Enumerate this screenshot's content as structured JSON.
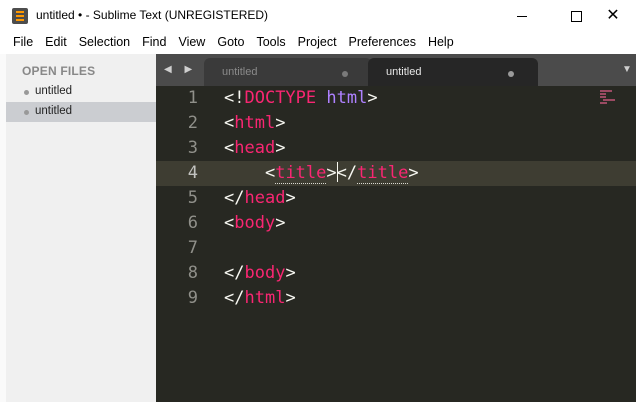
{
  "window": {
    "title": "untitled • - Sublime Text (UNREGISTERED)",
    "minimize": "–",
    "maximize": "□",
    "close": "✕"
  },
  "menu": [
    "File",
    "Edit",
    "Selection",
    "Find",
    "View",
    "Goto",
    "Tools",
    "Project",
    "Preferences",
    "Help"
  ],
  "sidebar": {
    "header": "OPEN FILES",
    "items": [
      {
        "label": "untitled",
        "active": false
      },
      {
        "label": "untitled",
        "active": true
      }
    ]
  },
  "tabs": {
    "nav": "◀ ▶",
    "items": [
      {
        "label": "untitled",
        "active": false
      },
      {
        "label": "untitled",
        "active": true
      }
    ],
    "dropdown": "▼"
  },
  "editor": {
    "current_line": 4,
    "lines": [
      {
        "n": "1",
        "text": "<!DOCTYPE html>"
      },
      {
        "n": "2",
        "text": "<html>"
      },
      {
        "n": "3",
        "text": "<head>"
      },
      {
        "n": "4",
        "text": "    <title></title>"
      },
      {
        "n": "5",
        "text": "</head>"
      },
      {
        "n": "6",
        "text": "<body>"
      },
      {
        "n": "7",
        "text": ""
      },
      {
        "n": "8",
        "text": "</body>"
      },
      {
        "n": "9",
        "text": "</html>"
      }
    ]
  },
  "colors": {
    "editor_bg": "#272822",
    "tag": "#f92672",
    "keyword": "#ae81ff",
    "text": "#f8f8f2",
    "line_number": "#90908a"
  }
}
